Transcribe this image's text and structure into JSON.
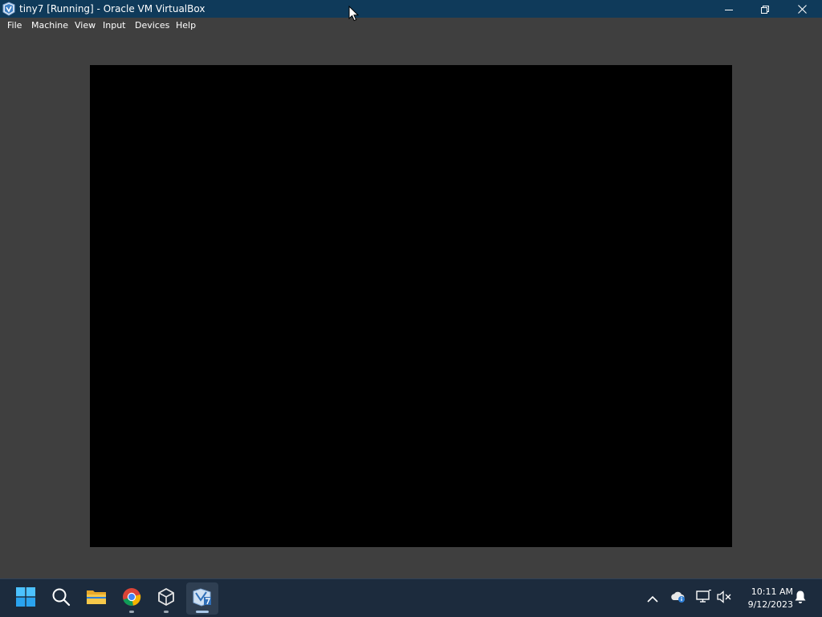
{
  "window": {
    "title": "tiny7 [Running] - Oracle VM VirtualBox",
    "icon": "virtualbox-vm-icon",
    "controls": {
      "minimize_icon": "minimize-icon",
      "restore_icon": "restore-icon",
      "close_icon": "close-icon"
    }
  },
  "menu": {
    "items": [
      {
        "label": "File"
      },
      {
        "label": "Machine"
      },
      {
        "label": "View"
      },
      {
        "label": "Input"
      },
      {
        "label": "Devices"
      },
      {
        "label": "Help"
      }
    ]
  },
  "taskbar": {
    "apps": [
      {
        "name": "start",
        "icon": "windows-logo-icon"
      },
      {
        "name": "search",
        "icon": "search-icon"
      },
      {
        "name": "file-explorer",
        "icon": "folder-icon"
      },
      {
        "name": "chrome",
        "icon": "chrome-icon"
      },
      {
        "name": "virtualbox-manager",
        "icon": "virtualbox-icon"
      },
      {
        "name": "vm-window",
        "icon": "virtualbox-vm-icon"
      }
    ],
    "tray": {
      "icons": [
        "chevron-up-icon",
        "onedrive-icon",
        "network-icon",
        "volume-muted-icon",
        "bell-icon"
      ],
      "time": "10:11 AM",
      "date": "9/12/2023"
    }
  },
  "colors": {
    "titlebar": "#0f3a5a",
    "background": "#3f3f3f",
    "vm_screen": "#000000",
    "taskbar": "#1c2b3d",
    "accent": "#3aa0f0"
  }
}
